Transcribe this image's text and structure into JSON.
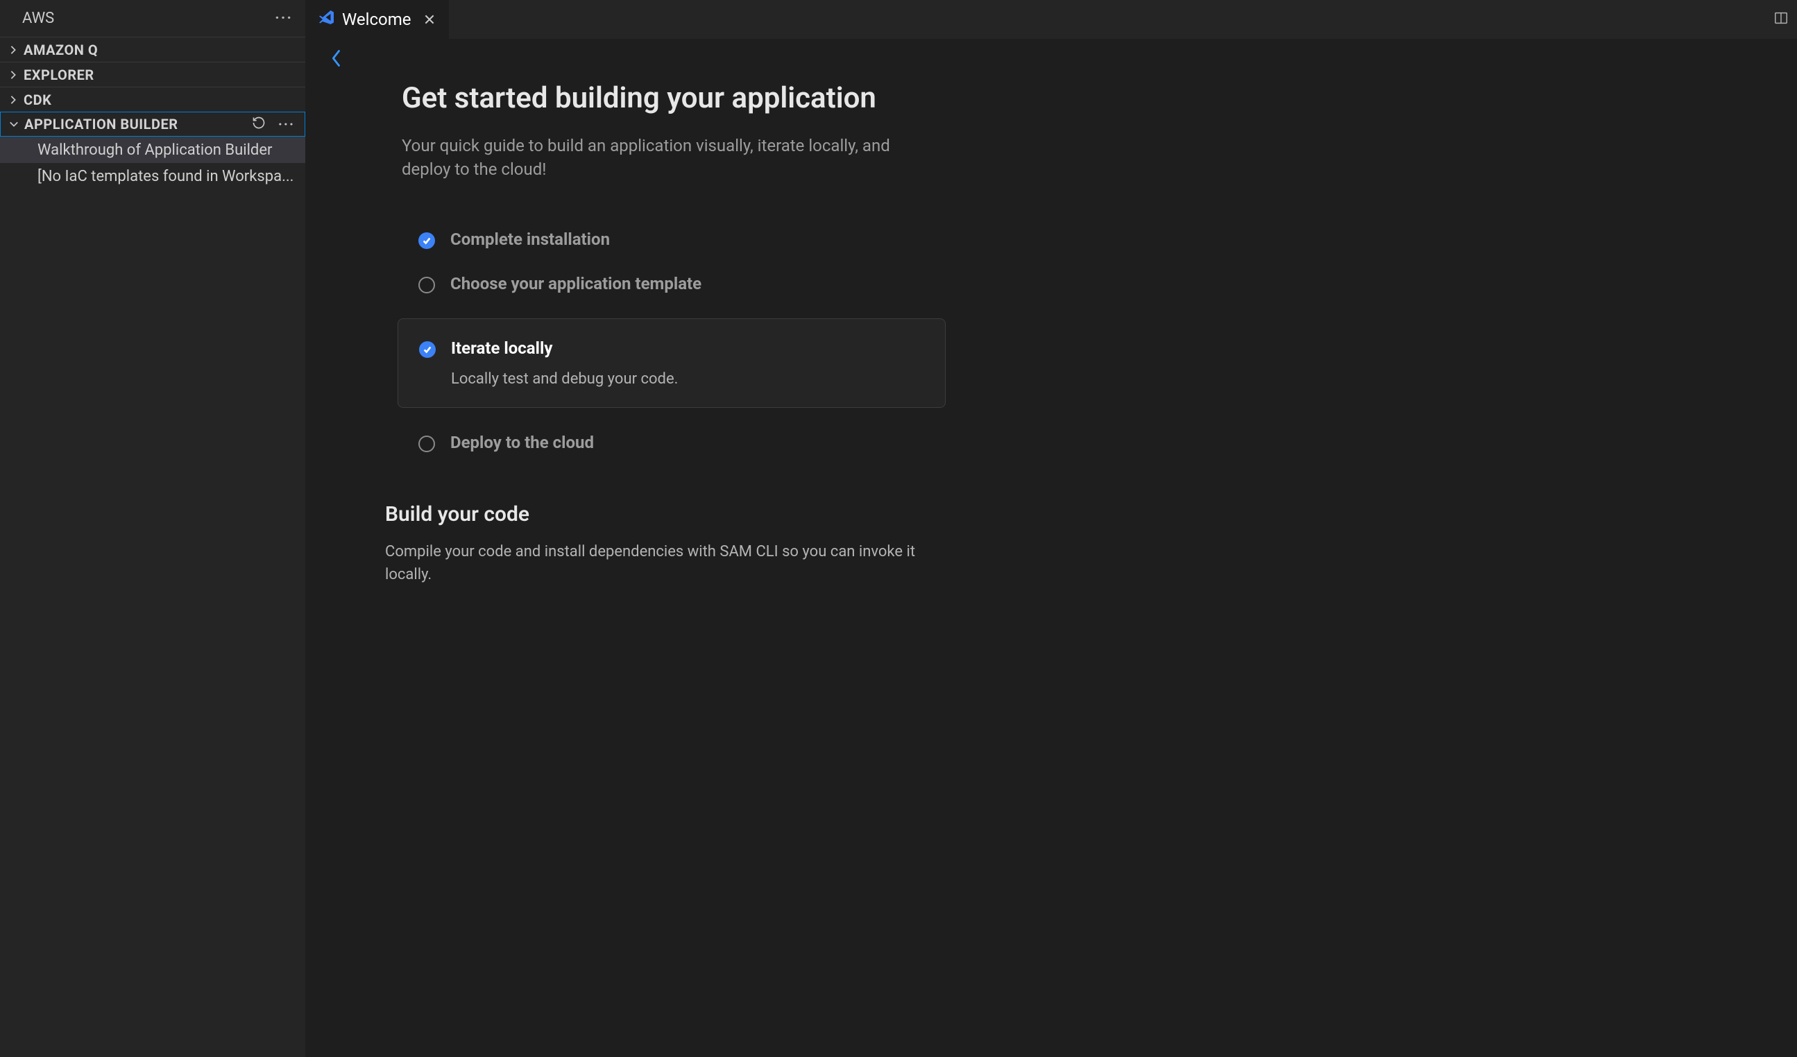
{
  "sidebar": {
    "title": "AWS",
    "sections": [
      {
        "label": "AMAZON Q",
        "expanded": false
      },
      {
        "label": "EXPLORER",
        "expanded": false
      },
      {
        "label": "CDK",
        "expanded": false
      },
      {
        "label": "APPLICATION BUILDER",
        "expanded": true,
        "items": [
          "Walkthrough of Application Builder",
          "[No IaC templates found in Workspa..."
        ]
      }
    ]
  },
  "tab": {
    "title": "Welcome"
  },
  "welcome": {
    "title": "Get started building your application",
    "subtitle": "Your quick guide to build an application visually, iterate locally, and deploy to the cloud!",
    "steps": [
      {
        "label": "Complete installation",
        "checked": true,
        "expanded": false
      },
      {
        "label": "Choose your application template",
        "checked": false,
        "expanded": false
      },
      {
        "label": "Iterate locally",
        "checked": true,
        "expanded": true,
        "desc": "Locally test and debug your code."
      },
      {
        "label": "Deploy to the cloud",
        "checked": false,
        "expanded": false
      }
    ],
    "subsection": {
      "heading": "Build your code",
      "text": "Compile your code and install dependencies with SAM CLI so you can invoke it locally."
    }
  }
}
